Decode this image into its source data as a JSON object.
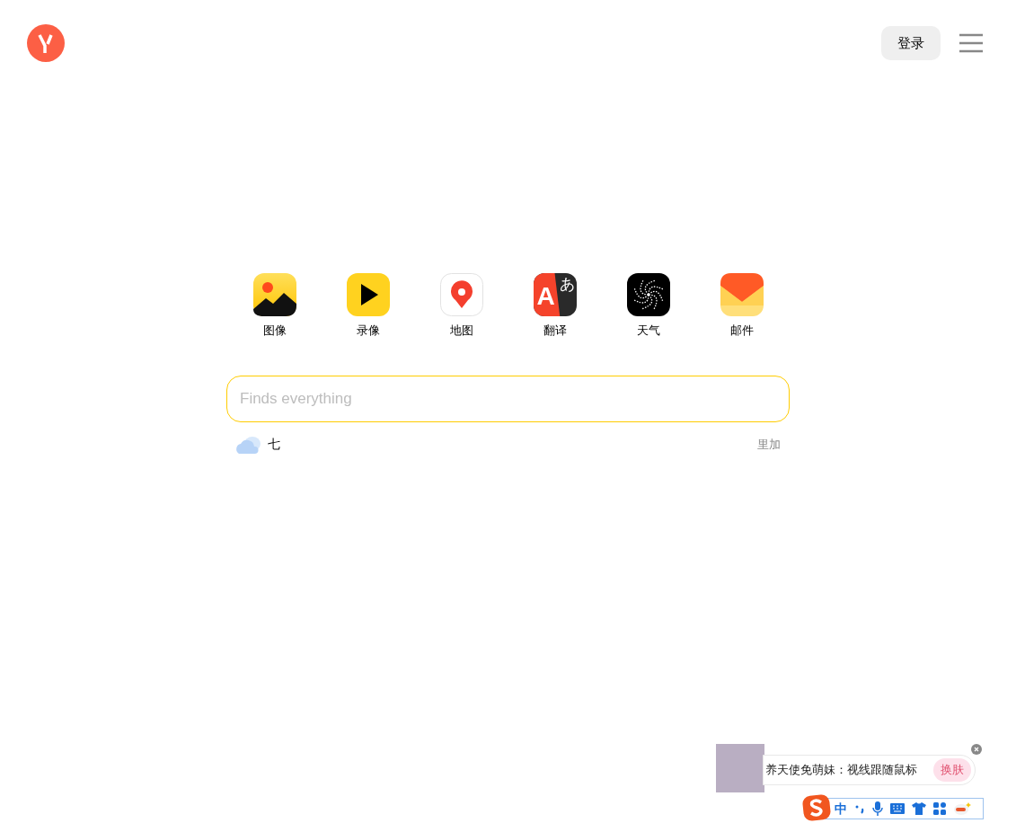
{
  "header": {
    "login_button": "登录"
  },
  "services": [
    {
      "kind": "images",
      "label": "图像"
    },
    {
      "kind": "video",
      "label": "录像"
    },
    {
      "kind": "maps",
      "label": "地图"
    },
    {
      "kind": "translate",
      "label": "翻译",
      "glyph": "あ",
      "letter": "A"
    },
    {
      "kind": "weather",
      "label": "天气"
    },
    {
      "kind": "mail",
      "label": "邮件"
    }
  ],
  "search": {
    "placeholder": "Finds everything"
  },
  "weather": {
    "temperature": "七",
    "more_link": "里加"
  },
  "ime_popup": {
    "message": "养天使免萌妹：视线跟随鼠标",
    "skin_button": "换肤"
  },
  "ime_toolbar": {
    "mode": "中"
  }
}
